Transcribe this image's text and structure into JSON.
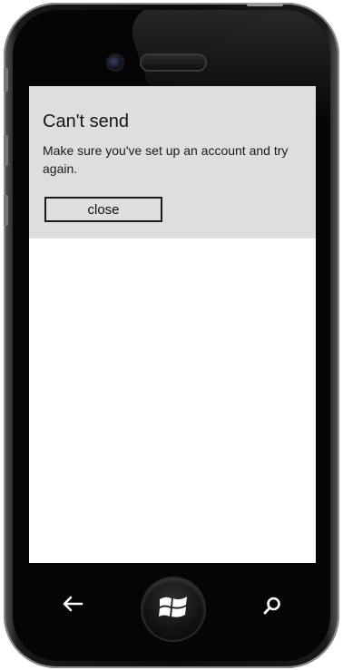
{
  "dialog": {
    "title": "Can't send",
    "message": "Make sure you've set up an account and try again.",
    "close_label": "close"
  },
  "navigation": {
    "back_icon": "back-arrow-icon",
    "home_icon": "windows-logo-icon",
    "search_icon": "search-icon"
  },
  "colors": {
    "dialog_background": "#dedede",
    "screen_background": "#ffffff",
    "phone_body": "#050505"
  }
}
